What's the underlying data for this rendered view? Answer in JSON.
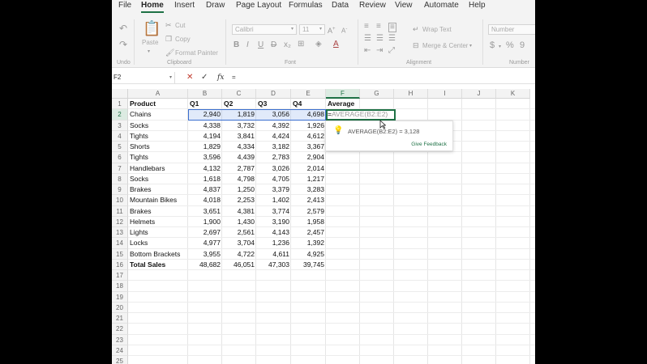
{
  "menu": {
    "tabs": [
      "File",
      "Home",
      "Insert",
      "Draw",
      "Page Layout",
      "Formulas",
      "Data",
      "Review",
      "View",
      "Automate",
      "Help"
    ],
    "active": "Home"
  },
  "ribbon": {
    "undo_group": "Undo",
    "clipboard": {
      "paste": "Paste",
      "cut": "Cut",
      "copy": "Copy",
      "format_painter": "Format Painter",
      "group": "Clipboard"
    },
    "font": {
      "name": "Calibri",
      "size": "11",
      "group": "Font"
    },
    "alignment": {
      "wrap_text": "Wrap Text",
      "merge_center": "Merge & Center",
      "group": "Alignment"
    },
    "number": {
      "format": "Number",
      "group": "Number"
    }
  },
  "formula_bar": {
    "name_box": "F2",
    "value": "=",
    "fx": "fx"
  },
  "grid": {
    "columns": [
      "A",
      "B",
      "C",
      "D",
      "E",
      "F",
      "G",
      "H",
      "I",
      "J",
      "K"
    ],
    "rows": [
      "1",
      "2",
      "3",
      "4",
      "5",
      "6",
      "7",
      "8",
      "9",
      "10",
      "11",
      "12",
      "13",
      "14",
      "15",
      "16",
      "17",
      "18",
      "19",
      "20",
      "21",
      "22",
      "23",
      "24",
      "25"
    ],
    "header": {
      "product": "Product",
      "q1": "Q1",
      "q2": "Q2",
      "q3": "Q3",
      "q4": "Q4",
      "average": "Average"
    },
    "data": [
      [
        "Chains",
        "2,940",
        "1,819",
        "3,056",
        "4,698"
      ],
      [
        "Socks",
        "4,338",
        "3,732",
        "4,392",
        "1,926"
      ],
      [
        "Tights",
        "4,194",
        "3,841",
        "4,424",
        "4,612"
      ],
      [
        "Shorts",
        "1,829",
        "4,334",
        "3,182",
        "3,367"
      ],
      [
        "Tights",
        "3,596",
        "4,439",
        "2,783",
        "2,904"
      ],
      [
        "Handlebars",
        "4,132",
        "2,787",
        "3,026",
        "2,014"
      ],
      [
        "Socks",
        "1,618",
        "4,798",
        "4,705",
        "1,217"
      ],
      [
        "Brakes",
        "4,837",
        "1,250",
        "3,379",
        "3,283"
      ],
      [
        "Mountain Bikes",
        "4,018",
        "2,253",
        "1,402",
        "2,413"
      ],
      [
        "Brakes",
        "3,651",
        "4,381",
        "3,774",
        "2,579"
      ],
      [
        "Helmets",
        "1,900",
        "1,430",
        "3,190",
        "1,958"
      ],
      [
        "Lights",
        "2,697",
        "2,561",
        "4,143",
        "2,457"
      ],
      [
        "Locks",
        "4,977",
        "3,704",
        "1,236",
        "1,392"
      ],
      [
        "Bottom Brackets",
        "3,955",
        "4,722",
        "4,611",
        "4,925"
      ]
    ],
    "total": [
      "Total Sales",
      "48,682",
      "46,051",
      "47,303",
      "39,745"
    ],
    "active_cell": {
      "typed": "=",
      "ghost": "AVERAGE(B2:E2)"
    }
  },
  "suggestion": {
    "text": "AVERAGE(B2:E2) = 3,128",
    "feedback": "Give Feedback"
  },
  "colors": {
    "accent": "#1e7145",
    "selection": "#3b6fcf"
  }
}
